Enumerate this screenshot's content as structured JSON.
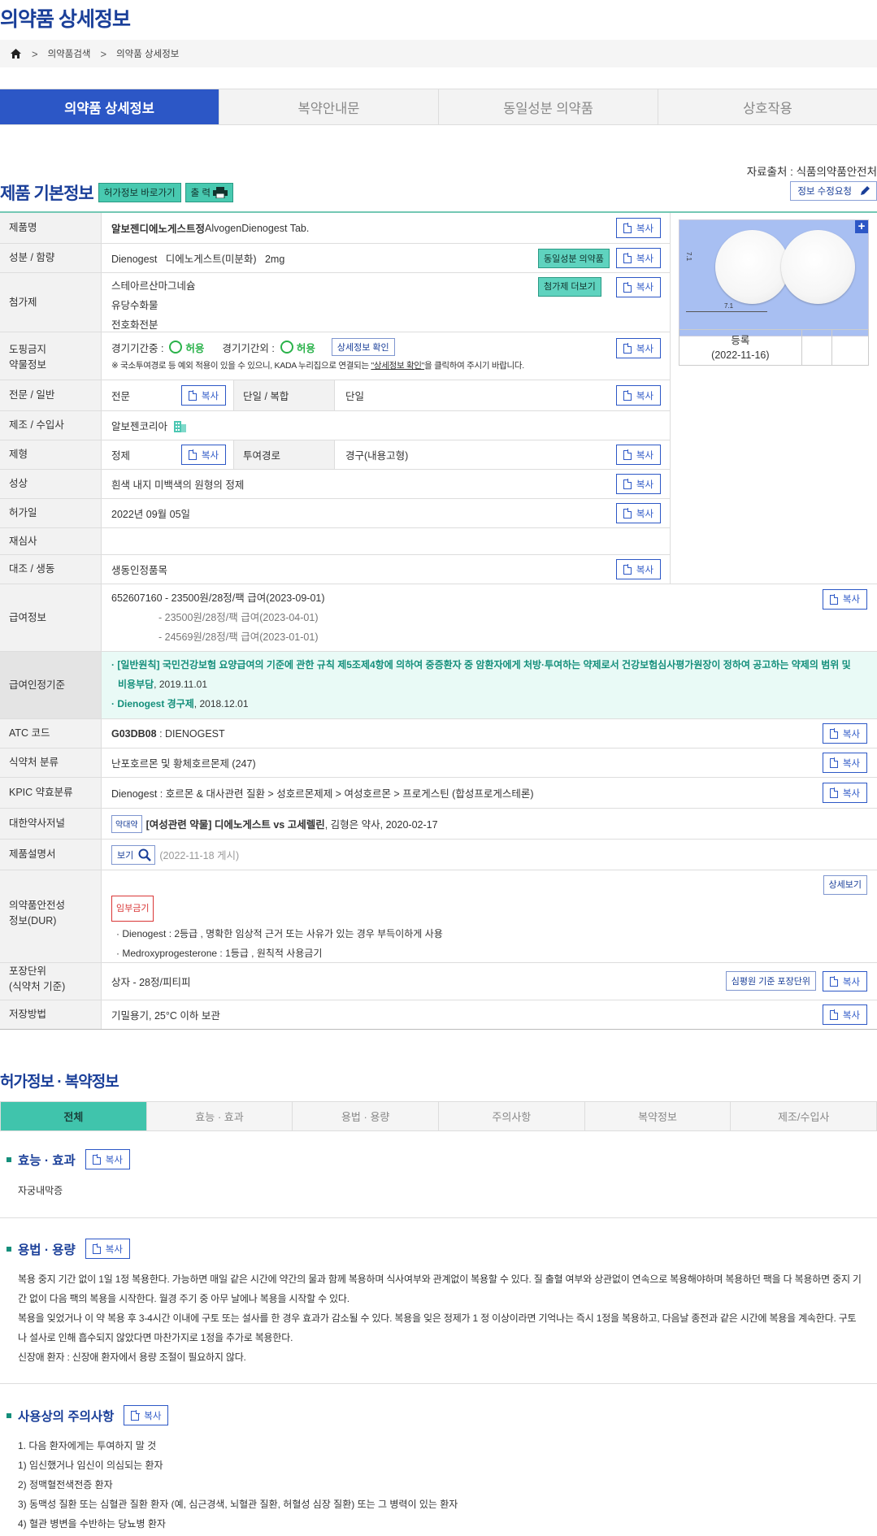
{
  "page_title": "의약품 상세정보",
  "breadcrumb": {
    "items": [
      "의약품검색",
      "의약품 상세정보"
    ]
  },
  "tabs": [
    "의약품 상세정보",
    "복약안내문",
    "동일성분 의약품",
    "상호작용"
  ],
  "source": "자료출처 : 식품의약품안전처",
  "section1": {
    "title": "제품 기본정보",
    "btn_permit": "허가정보 바로가기",
    "btn_print": "출 력",
    "btn_edit": "정보 수정요청"
  },
  "copy": "복사",
  "rows": {
    "name": {
      "label": "제품명",
      "bold": "알보젠디에노게스트정",
      "rest": " AlvogenDienogest Tab."
    },
    "ingredient": {
      "label": "성분 / 함량",
      "value": "Dienogest   디에노게스트(미분화)   2mg",
      "btn": "동일성분 의약품"
    },
    "additive": {
      "label": "첨가제",
      "values": [
        "스테아르산마그네슘",
        "유당수화물",
        "전호화전분"
      ],
      "btn": "첨가제 더보기"
    },
    "doping": {
      "label1": "도핑금지",
      "label2": "약물정보",
      "in_label": "경기기간중 :",
      "in_val": "허용",
      "out_label": "경기기간외 :",
      "out_val": "허용",
      "btn": "상세정보 확인",
      "note_pre": "※ 국소투여경로 등 예외 적용이 있을 수 있으니, KADA 누리집으로 연결되는 ",
      "note_link": "\"상세정보 확인\"",
      "note_post": "을 클릭하여 주시기 바랍니다."
    },
    "pro": {
      "label": "전문 / 일반",
      "value": "전문",
      "label2": "단일 / 복합",
      "value2": "단일"
    },
    "maker": {
      "label": "제조 / 수입사",
      "value": "알보젠코리아"
    },
    "form": {
      "label": "제형",
      "value": "정제",
      "label2": "투여경로",
      "value2": "경구(내용고형)"
    },
    "shape": {
      "label": "성상",
      "value": "흰색 내지 미백색의 원형의 정제"
    },
    "permit_date": {
      "label": "허가일",
      "value": "2022년 09월 05일"
    },
    "reexam": {
      "label": "재심사",
      "value": ""
    },
    "bio": {
      "label": "대조 / 생동",
      "value": "생동인정품목"
    },
    "pay": {
      "label": "급여정보",
      "values": [
        "652607160 - 23500원/28정/팩 급여(2023-09-01)",
        "- 23500원/28정/팩 급여(2023-04-01)",
        "- 24569원/28정/팩 급여(2023-01-01)"
      ]
    },
    "criteria": {
      "label": "급여인정기준",
      "line1_pre": "· [일반원칙] 국민건강보험 요양급여의 기준에 관한 규칙 제5조제4항에 의하여 중증환자 중 암환자에게 처방·투여하는 약제로서 건강보험심사평가원장이 정하여 공고하는 약제의 범위 및",
      "line1_b": "비용부담",
      "line1_post": ", 2019.11.01",
      "line2_b": "· Dienogest 경구제",
      "line2_post": ", 2018.12.01"
    },
    "atc": {
      "label": "ATC 코드",
      "bold": "G03DB08",
      "rest": " : DIENOGEST"
    },
    "mfds": {
      "label": "식약처 분류",
      "value": "난포호르몬 및 황체호르몬제 (247)"
    },
    "kpic": {
      "label": "KPIC 약효분류",
      "value": "Dienogest : 호르몬 & 대사관련 질환 > 성호르몬제제 > 여성호르몬 > 프로게스틴 (합성프로게스테론)"
    },
    "journal": {
      "label": "대한약사저널",
      "tag": "약대약",
      "bold": "[여성관련 약물] 디에노게스트 vs 고세렐린",
      "rest": ", 김형은 약사, 2020-02-17"
    },
    "manual": {
      "label": "제품설명서",
      "btn": "보기",
      "date": "(2022-11-18 게시)"
    },
    "dur": {
      "label1": "의약품안전성",
      "label2": "정보(DUR)",
      "badge": "임부금기",
      "items": [
        "· Dienogest : 2등급 , 명확한 임상적 근거 또는 사유가 있는 경우 부득이하게 사용",
        "· Medroxyprogesterone : 1등급 , 원칙적 사용금기"
      ],
      "btn": "상세보기"
    },
    "pack": {
      "label1": "포장단위",
      "label2": "(식약처 기준)",
      "value": "상자 - 28정/피티피",
      "btn": "심평원 기준 포장단위"
    },
    "storage": {
      "label": "저장방법",
      "value": "기밀용기, 25°C 이하 보관"
    }
  },
  "image": {
    "caption1": "등록",
    "caption2": "(2022-11-16)",
    "scale_x": "7.1",
    "scale_y": "7.1"
  },
  "section2": {
    "title": "허가정보 · 복약정보",
    "tabs": [
      "전체",
      "효능 · 효과",
      "용법 · 용량",
      "주의사항",
      "복약정보",
      "제조/수입사"
    ]
  },
  "efficacy": {
    "title": "효능 · 효과",
    "text": "자궁내막증"
  },
  "dosage": {
    "title": "용법 · 용량",
    "lines": [
      "복용 중지 기간 없이 1일 1정 복용한다. 가능하면 매일 같은 시간에 약간의 물과 함께 복용하며 식사여부와 관계없이 복용할 수 있다. 질 출혈 여부와 상관없이 연속으로 복용해야하며 복용하던 팩을 다 복용하면 중지 기",
      "간 없이 다음 팩의 복용을 시작한다. 월경 주기 중 아무 날에나 복용을 시작할 수 있다.",
      "복용을 잊었거나 이 약 복용 후 3-4시간 이내에 구토 또는 설사를 한 경우 효과가 감소될 수 있다. 복용을 잊은 정제가 1 정 이상이라면 기억나는 즉시 1정을 복용하고, 다음날 종전과 같은 시간에 복용을 계속한다. 구토",
      "나 설사로 인해 흡수되지 않았다면 마찬가지로 1정을 추가로 복용한다.",
      "신장애 환자 : 신장애 환자에서 용량 조절이 필요하지 않다."
    ]
  },
  "caution": {
    "title": "사용상의 주의사항",
    "lines": [
      "1. 다음 환자에게는 투여하지 말 것",
      "1) 임신했거나 임신이 의심되는 환자",
      "2) 정맥혈전색전증 환자",
      "3) 동맥성 질환 또는 심혈관 질환 환자 (예, 심근경색, 뇌혈관 질환, 허혈성 심장 질환) 또는 그 병력이 있는 환자",
      "4) 혈관 병변을 수반하는 당뇨병 환자"
    ]
  }
}
